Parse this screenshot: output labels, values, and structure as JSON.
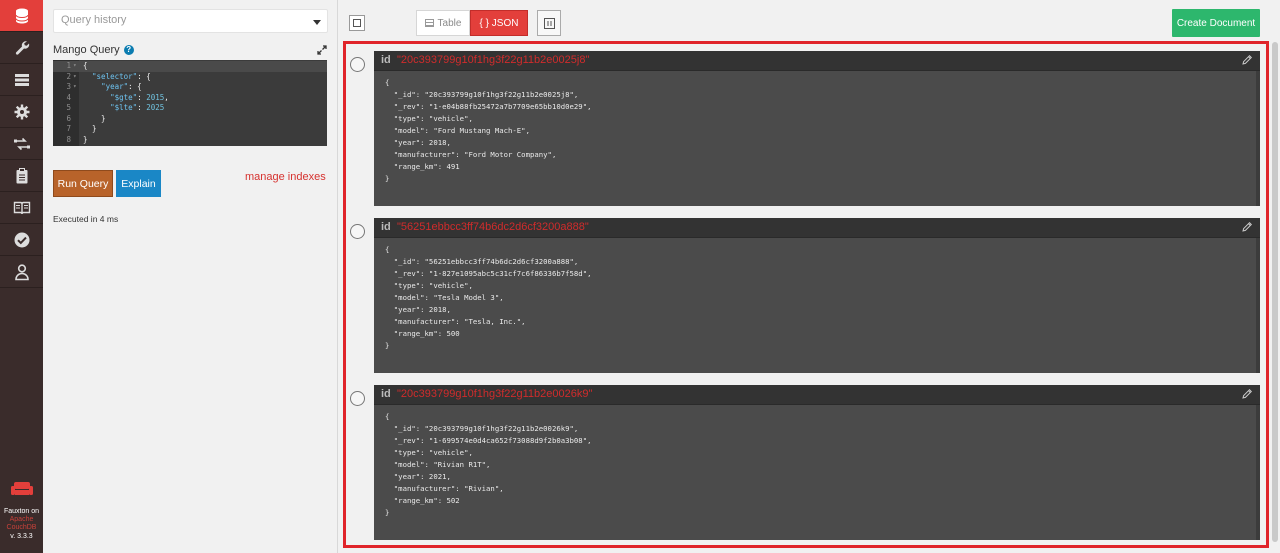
{
  "nav": {
    "items": [
      {
        "name": "databases",
        "icon": "database-icon"
      },
      {
        "name": "setup",
        "icon": "wrench-icon"
      },
      {
        "name": "active-tasks",
        "icon": "tasks-icon"
      },
      {
        "name": "config",
        "icon": "gear-icon"
      },
      {
        "name": "replication",
        "icon": "replication-icon"
      },
      {
        "name": "logs",
        "icon": "clipboard-icon"
      },
      {
        "name": "documentation",
        "icon": "book-icon"
      },
      {
        "name": "verify",
        "icon": "check-circle-icon"
      },
      {
        "name": "user",
        "icon": "user-icon"
      }
    ],
    "footer_line1": "Fauxton on",
    "footer_line2": "Apache",
    "footer_line3": "CouchDB",
    "footer_version": "v. 3.3.3"
  },
  "query": {
    "history_placeholder": "Query history",
    "title": "Mango Query",
    "editor_lines": [
      {
        "n": "1",
        "fold": "▾",
        "text": "{"
      },
      {
        "n": "2",
        "fold": "▾",
        "text": "  \"selector\": {"
      },
      {
        "n": "3",
        "fold": "▾",
        "text": "    \"year\": {"
      },
      {
        "n": "4",
        "fold": "",
        "text": "      \"$gte\": 2015,"
      },
      {
        "n": "5",
        "fold": "",
        "text": "      \"$lte\": 2025"
      },
      {
        "n": "6",
        "fold": "",
        "text": "    }"
      },
      {
        "n": "7",
        "fold": "",
        "text": "  }"
      },
      {
        "n": "8",
        "fold": "",
        "text": "}"
      }
    ],
    "run_label": "Run Query",
    "explain_label": "Explain",
    "manage_indexes_label": "manage indexes",
    "executed_text": "Executed in 4 ms"
  },
  "toolbar": {
    "table_label": "Table",
    "json_label": "{ } JSON",
    "create_document_label": "Create Document"
  },
  "documents": [
    {
      "id_label": "id",
      "id": "\"20c393799g10f1hg3f22g11b2e0025j8\"",
      "body": "{\n  \"_id\": \"20c393799g10f1hg3f22g11b2e0025j8\",\n  \"_rev\": \"1-e04b88fb25472a7b7709e65bb10d0e29\",\n  \"type\": \"vehicle\",\n  \"model\": \"Ford Mustang Mach-E\",\n  \"year\": 2018,\n  \"manufacturer\": \"Ford Motor Company\",\n  \"range_km\": 491\n}"
    },
    {
      "id_label": "id",
      "id": "\"56251ebbcc3ff74b6dc2d6cf3200a888\"",
      "body": "{\n  \"_id\": \"56251ebbcc3ff74b6dc2d6cf3200a888\",\n  \"_rev\": \"1-827e1095abc5c31cf7c6f86336b7f58d\",\n  \"type\": \"vehicle\",\n  \"model\": \"Tesla Model 3\",\n  \"year\": 2018,\n  \"manufacturer\": \"Tesla, Inc.\",\n  \"range_km\": 500\n}"
    },
    {
      "id_label": "id",
      "id": "\"20c393799g10f1hg3f22g11b2e0026k9\"",
      "body": "{\n  \"_id\": \"20c393799g10f1hg3f22g11b2e0026k9\",\n  \"_rev\": \"1-699574e0d4ca652f73088d9f2b0a3b08\",\n  \"type\": \"vehicle\",\n  \"model\": \"Rivian R1T\",\n  \"year\": 2021,\n  \"manufacturer\": \"Rivian\",\n  \"range_km\": 502\n}"
    }
  ],
  "colors": {
    "accent": "#e33f3b",
    "nav_bg": "#3a2c2b",
    "run_button": "#b8632a",
    "explain_button": "#1a87c6",
    "create_button": "#2db76d",
    "selection_border": "#e0242a"
  }
}
